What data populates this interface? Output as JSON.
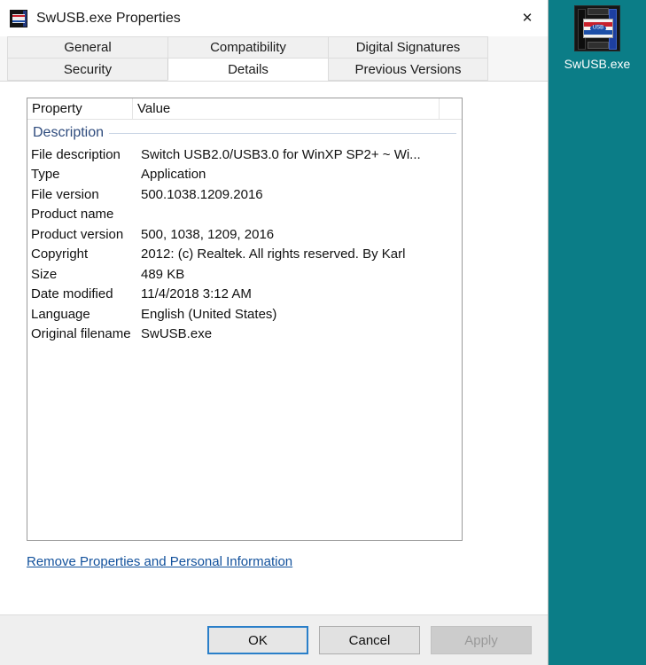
{
  "desktop": {
    "background_color": "#0b7d87",
    "icon": {
      "name": "SwUSB.exe",
      "glyph_text": "USB"
    }
  },
  "window": {
    "title": "SwUSB.exe Properties",
    "close_label": "✕",
    "icon_name": "swusb-app-icon"
  },
  "tabs": {
    "row1": [
      {
        "label": "General",
        "selected": false
      },
      {
        "label": "Compatibility",
        "selected": false
      },
      {
        "label": "Digital Signatures",
        "selected": false
      }
    ],
    "row2": [
      {
        "label": "Security",
        "selected": false
      },
      {
        "label": "Details",
        "selected": true
      },
      {
        "label": "Previous Versions",
        "selected": false
      }
    ]
  },
  "details": {
    "columns": [
      "Property",
      "Value"
    ],
    "group_header": "Description",
    "rows": [
      {
        "property": "File description",
        "value": "Switch USB2.0/USB3.0 for WinXP SP2+ ~ Wi..."
      },
      {
        "property": "Type",
        "value": "Application"
      },
      {
        "property": "File version",
        "value": "500.1038.1209.2016"
      },
      {
        "property": "Product name",
        "value": ""
      },
      {
        "property": "Product version",
        "value": "500, 1038, 1209, 2016"
      },
      {
        "property": "Copyright",
        "value": "2012: (c) Realtek.  All rights reserved. By Karl"
      },
      {
        "property": "Size",
        "value": "489 KB"
      },
      {
        "property": "Date modified",
        "value": "11/4/2018 3:12 AM"
      },
      {
        "property": "Language",
        "value": "English (United States)"
      },
      {
        "property": "Original filename",
        "value": "SwUSB.exe"
      }
    ],
    "remove_link": "Remove Properties and Personal Information"
  },
  "buttons": {
    "ok": "OK",
    "cancel": "Cancel",
    "apply": "Apply"
  },
  "colors": {
    "desktop_teal": "#0b7d87",
    "link_blue": "#12519c",
    "group_header_blue": "#2e4b7d",
    "focus_border": "#2a7fc9"
  }
}
